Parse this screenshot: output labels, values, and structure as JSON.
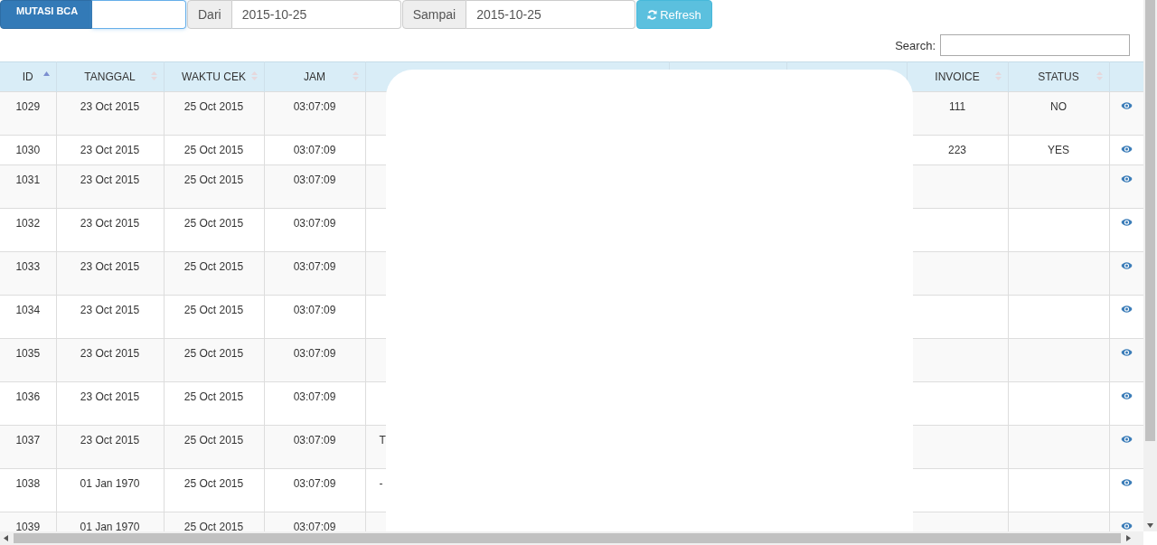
{
  "toolbar": {
    "source_label": "MUTASI BCA",
    "from": {
      "label": "Dari",
      "value": "2015-10-25"
    },
    "to": {
      "label": "Sampai",
      "value": "2015-10-25"
    },
    "refresh_button": "Refresh"
  },
  "search": {
    "label": "Search:"
  },
  "table": {
    "columns": [
      {
        "label": "ID",
        "sorted": true
      },
      {
        "label": "TANGGAL",
        "sorted": false
      },
      {
        "label": "WAKTU CEK",
        "sorted": false
      },
      {
        "label": "JAM",
        "sorted": false
      },
      {
        "label": "INVOICE",
        "sorted": false
      },
      {
        "label": "STATUS",
        "sorted": false
      }
    ],
    "rows": [
      {
        "id": "1029",
        "tanggal": "23 Oct 2015",
        "waktu_cek": "25 Oct 2015",
        "jam": "03:07:09",
        "invoice": "111",
        "status": "NO"
      },
      {
        "id": "1030",
        "tanggal": "23 Oct 2015",
        "waktu_cek": "25 Oct 2015",
        "jam": "03:07:09",
        "invoice": "223",
        "status": "YES"
      },
      {
        "id": "1031",
        "tanggal": "23 Oct 2015",
        "waktu_cek": "25 Oct 2015",
        "jam": "03:07:09"
      },
      {
        "id": "1032",
        "tanggal": "23 Oct 2015",
        "waktu_cek": "25 Oct 2015",
        "jam": "03:07:09"
      },
      {
        "id": "1033",
        "tanggal": "23 Oct 2015",
        "waktu_cek": "25 Oct 2015",
        "jam": "03:07:09"
      },
      {
        "id": "1034",
        "tanggal": "23 Oct 2015",
        "waktu_cek": "25 Oct 2015",
        "jam": "03:07:09"
      },
      {
        "id": "1035",
        "tanggal": "23 Oct 2015",
        "waktu_cek": "25 Oct 2015",
        "jam": "03:07:09"
      },
      {
        "id": "1036",
        "tanggal": "23 Oct 2015",
        "waktu_cek": "25 Oct 2015",
        "jam": "03:07:09"
      },
      {
        "id": "1037",
        "tanggal": "23 Oct 2015",
        "waktu_cek": "25 Oct 2015",
        "jam": "03:07:09",
        "column_5": "T"
      },
      {
        "id": "1038",
        "tanggal": "01 Jan 1970",
        "waktu_cek": "25 Oct 2015",
        "jam": "03:07:09",
        "column_5": "-"
      },
      {
        "id": "1039",
        "tanggal": "01 Jan 1970",
        "waktu_cek": "25 Oct 2015",
        "jam": "03:07:09"
      }
    ]
  }
}
